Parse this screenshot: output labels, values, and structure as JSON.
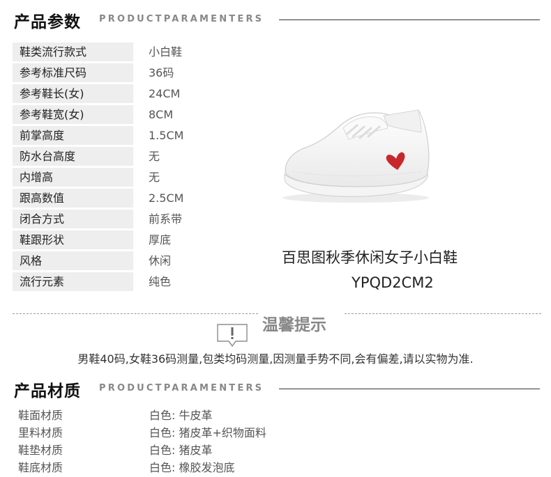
{
  "params_section": {
    "title": "产品参数",
    "subtitle": "PRODUCTPARAMENTERS"
  },
  "params": [
    {
      "key": "鞋类流行款式",
      "value": "小白鞋"
    },
    {
      "key": "参考标准尺码",
      "value": "36码"
    },
    {
      "key": "参考鞋长(女)",
      "value": "24CM"
    },
    {
      "key": "参考鞋宽(女)",
      "value": "8CM"
    },
    {
      "key": "前掌高度",
      "value": "1.5CM"
    },
    {
      "key": "防水台高度",
      "value": "无"
    },
    {
      "key": "内增高",
      "value": "无"
    },
    {
      "key": "跟高数值",
      "value": "2.5CM"
    },
    {
      "key": "闭合方式",
      "value": "前系带"
    },
    {
      "key": "鞋跟形状",
      "value": "厚底"
    },
    {
      "key": "风格",
      "value": "休闲"
    },
    {
      "key": "流行元素",
      "value": "纯色"
    }
  ],
  "product": {
    "caption": "百思图秋季休闲女子小白鞋",
    "model": "YPQD2CM2"
  },
  "tip": {
    "title": "温馨提示",
    "icon": "exclamation-bubble-icon",
    "text": "男鞋40码,女鞋36码测量,包类均码测量,因测量手势不同,会有偏差,请以实物为准."
  },
  "materials_section": {
    "title": "产品材质",
    "subtitle": "PRODUCTPARAMENTERS"
  },
  "materials": [
    {
      "key": "鞋面材质",
      "value": "白色: 牛皮革"
    },
    {
      "key": "里料材质",
      "value": "白色: 猪皮革+织物面料"
    },
    {
      "key": "鞋垫材质",
      "value": "白色: 猪皮革"
    },
    {
      "key": "鞋底材质",
      "value": "白色: 橡胶发泡底"
    }
  ],
  "colors": {
    "accent_heart": "#c8282c",
    "label_bg": "#eeeeee"
  }
}
